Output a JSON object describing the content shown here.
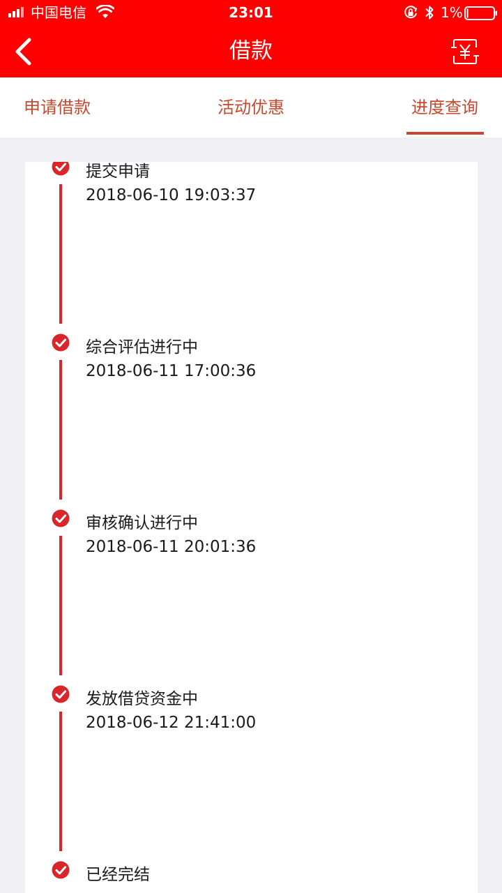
{
  "status_bar": {
    "carrier": "中国电信",
    "time": "23:01",
    "battery": "1%"
  },
  "nav": {
    "title": "借款"
  },
  "tabs": [
    {
      "label": "申请借款",
      "active": false
    },
    {
      "label": "活动优惠",
      "active": false
    },
    {
      "label": "进度查询",
      "active": true
    }
  ],
  "timeline": [
    {
      "title": "提交申请",
      "time": "2018-06-10 19:03:37"
    },
    {
      "title": "综合评估进行中",
      "time": "2018-06-11 17:00:36"
    },
    {
      "title": "审核确认进行中",
      "time": "2018-06-11 20:01:36"
    },
    {
      "title": "发放借贷资金中",
      "time": "2018-06-12 21:41:00"
    },
    {
      "title": "已经完结",
      "time": ""
    }
  ],
  "colors": {
    "nav_background": "#ff0000",
    "accent": "#c9472d",
    "timeline": "#d9262b",
    "page_background": "#efeff4"
  },
  "icons": {
    "back": "chevron-left-icon",
    "exchange": "yuan-exchange-icon",
    "step": "check-circle-icon"
  }
}
